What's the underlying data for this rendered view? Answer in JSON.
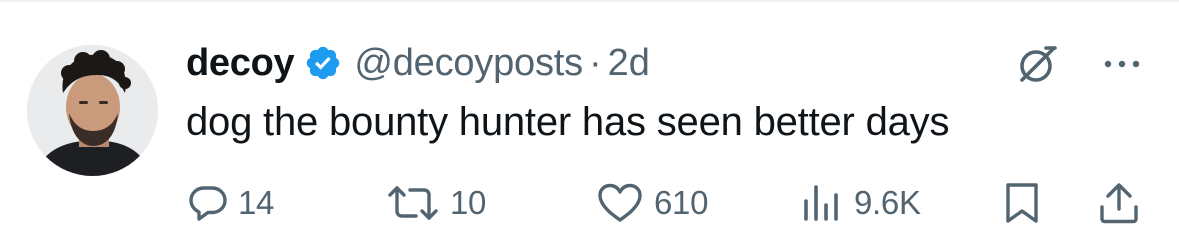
{
  "tweet": {
    "display_name": "decoy",
    "handle": "@decoyposts",
    "separator": "·",
    "timestamp": "2d",
    "text": "dog the bounty hunter has seen better days"
  },
  "icons": {
    "verified": "verified-badge-icon",
    "grok": "grok-icon",
    "more": "more-icon",
    "reply": "reply-icon",
    "repost": "repost-icon",
    "like": "heart-icon",
    "views": "views-icon",
    "bookmark": "bookmark-icon",
    "share": "share-icon"
  },
  "actions": {
    "replies": "14",
    "reposts": "10",
    "likes": "610",
    "views": "9.6K"
  },
  "colors": {
    "text_primary": "#0f1419",
    "text_secondary": "#536471",
    "verified_blue": "#1d9bf0"
  }
}
